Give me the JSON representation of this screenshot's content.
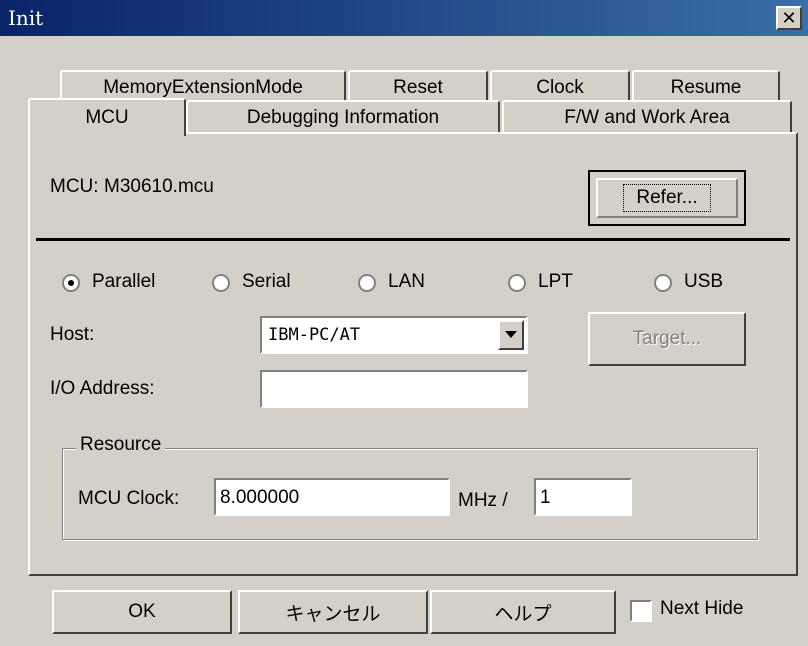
{
  "window": {
    "title": "Init",
    "close_symbol": "✕"
  },
  "tabs": {
    "row1": [
      "MemoryExtensionMode",
      "Reset",
      "Clock",
      "Resume"
    ],
    "row2": [
      "MCU",
      "Debugging Information",
      "F/W and Work Area"
    ]
  },
  "mcu": {
    "label": "MCU:",
    "value": "M30610.mcu",
    "refer_button": "Refer..."
  },
  "connection": {
    "options": [
      "Parallel",
      "Serial",
      "LAN",
      "LPT",
      "USB"
    ],
    "selected": "Parallel"
  },
  "host": {
    "label": "Host:",
    "value": "IBM-PC/AT",
    "target_button": "Target..."
  },
  "io_address": {
    "label": "I/O Address:",
    "value": ""
  },
  "resource": {
    "legend": "Resource",
    "clock_label": "MCU Clock:",
    "clock_value": "8.000000",
    "unit": "MHz /",
    "divider_value": "1"
  },
  "footer": {
    "ok": "OK",
    "cancel": "キャンセル",
    "help": "ヘルプ",
    "next_hide": "Next Hide"
  }
}
